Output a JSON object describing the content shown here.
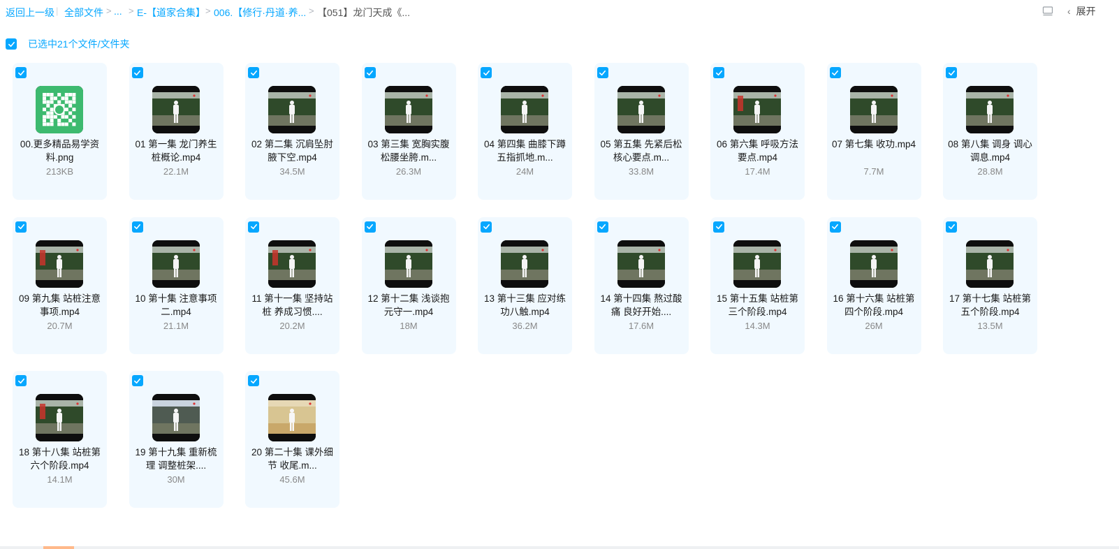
{
  "breadcrumb": {
    "back": "返回上一级",
    "all_files": "全部文件",
    "ellipsis": "...",
    "level1": "E-【道家合集】",
    "level2": "006.【修行·丹道·养...",
    "current": "【051】龙门天成《..."
  },
  "toolbar": {
    "expand_label": "展开"
  },
  "selection": {
    "text": "已选中21个文件/文件夹"
  },
  "files": [
    {
      "name": "00.更多精品易学资料.png",
      "size": "213KB",
      "type": "qr"
    },
    {
      "name": "01 第一集 龙门养生桩概论.mp4",
      "size": "22.1M",
      "type": "video"
    },
    {
      "name": "02 第二集 沉肩坠肘腋下空.mp4",
      "size": "34.5M",
      "type": "video"
    },
    {
      "name": "03 第三集 宽胸实腹 松腰坐胯.m...",
      "size": "26.3M",
      "type": "video"
    },
    {
      "name": "04 第四集 曲膝下蹲 五指抓地.m...",
      "size": "24M",
      "type": "video"
    },
    {
      "name": "05 第五集 先紧后松 核心要点.m...",
      "size": "33.8M",
      "type": "video"
    },
    {
      "name": "06 第六集 呼吸方法要点.mp4",
      "size": "17.4M",
      "type": "video-red"
    },
    {
      "name": "07 第七集 收功.mp4",
      "size": "7.7M",
      "type": "video"
    },
    {
      "name": "08 第八集 调身 调心 调息.mp4",
      "size": "28.8M",
      "type": "video"
    },
    {
      "name": "09 第九集 站桩注意事项.mp4",
      "size": "20.7M",
      "type": "video-red"
    },
    {
      "name": "10 第十集 注意事项二.mp4",
      "size": "21.1M",
      "type": "video"
    },
    {
      "name": "11 第十一集 坚持站桩 养成习惯....",
      "size": "20.2M",
      "type": "video-red"
    },
    {
      "name": "12 第十二集 浅谈抱元守一.mp4",
      "size": "18M",
      "type": "video"
    },
    {
      "name": "13 第十三集 应对练功八触.mp4",
      "size": "36.2M",
      "type": "video"
    },
    {
      "name": "14 第十四集 熬过酸痛 良好开始....",
      "size": "17.6M",
      "type": "video"
    },
    {
      "name": "15 第十五集 站桩第三个阶段.mp4",
      "size": "14.3M",
      "type": "video"
    },
    {
      "name": "16 第十六集 站桩第四个阶段.mp4",
      "size": "26M",
      "type": "video"
    },
    {
      "name": "17 第十七集 站桩第五个阶段.mp4",
      "size": "13.5M",
      "type": "video"
    },
    {
      "name": "18 第十八集 站桩第六个阶段.mp4",
      "size": "14.1M",
      "type": "video-red"
    },
    {
      "name": "19 第十九集 重新梳理 调整桩架....",
      "size": "30M",
      "type": "video-sky"
    },
    {
      "name": "20 第二十集 课外细节 收尾.m...",
      "size": "45.6M",
      "type": "video-indoor"
    }
  ],
  "icons": {
    "checkbox": "checkbox-checked-icon",
    "list_view": "list-view-icon",
    "expand": "chevron-left-icon"
  },
  "colors": {
    "accent": "#06a7ff",
    "card_bg": "#f1f9ff",
    "qr_bg": "#3dba6f"
  }
}
